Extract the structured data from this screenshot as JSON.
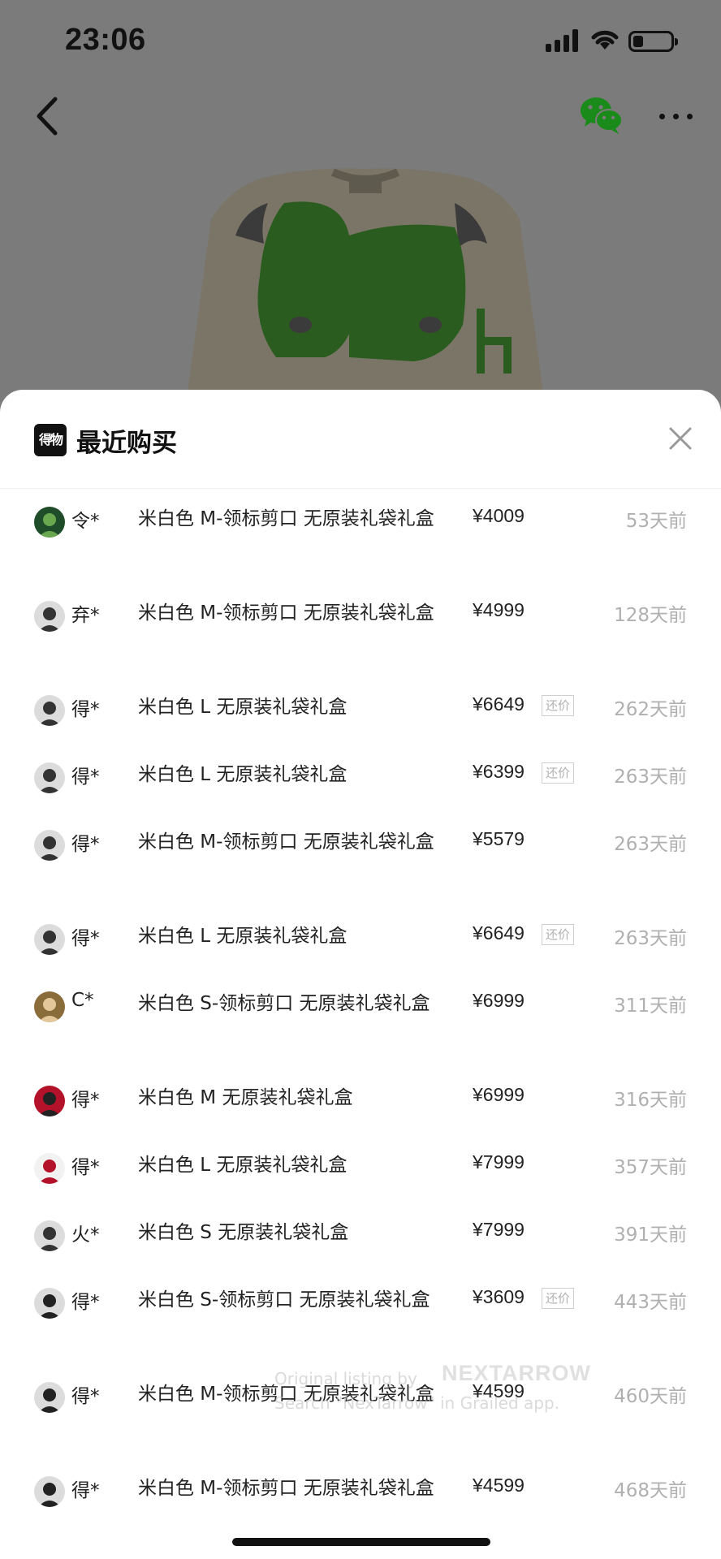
{
  "status": {
    "time": "23:06"
  },
  "sheet": {
    "title": "最近购买",
    "logo_text": "得物"
  },
  "purchases": [
    {
      "buyer": "令*",
      "spec": "米白色 M-领标剪口 无原装礼袋礼盒",
      "price": "¥4009",
      "tag": "",
      "ago": "53天前"
    },
    {
      "buyer": "弃*",
      "spec": "米白色 M-领标剪口 无原装礼袋礼盒",
      "price": "¥4999",
      "tag": "",
      "ago": "128天前"
    },
    {
      "buyer": "得*",
      "spec": "米白色 L 无原装礼袋礼盒",
      "price": "¥6649",
      "tag": "还价",
      "ago": "262天前"
    },
    {
      "buyer": "得*",
      "spec": "米白色 L 无原装礼袋礼盒",
      "price": "¥6399",
      "tag": "还价",
      "ago": "263天前"
    },
    {
      "buyer": "得*",
      "spec": "米白色 M-领标剪口 无原装礼袋礼盒",
      "price": "¥5579",
      "tag": "",
      "ago": "263天前"
    },
    {
      "buyer": "得*",
      "spec": "米白色 L 无原装礼袋礼盒",
      "price": "¥6649",
      "tag": "还价",
      "ago": "263天前"
    },
    {
      "buyer": "C*",
      "spec": "米白色 S-领标剪口 无原装礼袋礼盒",
      "price": "¥6999",
      "tag": "",
      "ago": "311天前"
    },
    {
      "buyer": "得*",
      "spec": "米白色 M 无原装礼袋礼盒",
      "price": "¥6999",
      "tag": "",
      "ago": "316天前"
    },
    {
      "buyer": "得*",
      "spec": "米白色 L 无原装礼袋礼盒",
      "price": "¥7999",
      "tag": "",
      "ago": "357天前"
    },
    {
      "buyer": "火*",
      "spec": "米白色 S 无原装礼袋礼盒",
      "price": "¥7999",
      "tag": "",
      "ago": "391天前"
    },
    {
      "buyer": "得*",
      "spec": "米白色 S-领标剪口 无原装礼袋礼盒",
      "price": "¥3609",
      "tag": "还价",
      "ago": "443天前"
    },
    {
      "buyer": "得*",
      "spec": "米白色 M-领标剪口 无原装礼袋礼盒",
      "price": "¥4599",
      "tag": "",
      "ago": "460天前"
    },
    {
      "buyer": "得*",
      "spec": "米白色 M-领标剪口 无原装礼袋礼盒",
      "price": "¥4599",
      "tag": "",
      "ago": "468天前"
    }
  ],
  "watermark": {
    "line1": "Original listing by",
    "brand": "NEXTARROW",
    "line2": "Search \"NexTarrow\" in Grailed app."
  },
  "colors": {
    "overlay": "#7b7b7b",
    "price_text": "#222222",
    "muted_text": "#b0b0b0",
    "icon_green": "#1aad19"
  }
}
